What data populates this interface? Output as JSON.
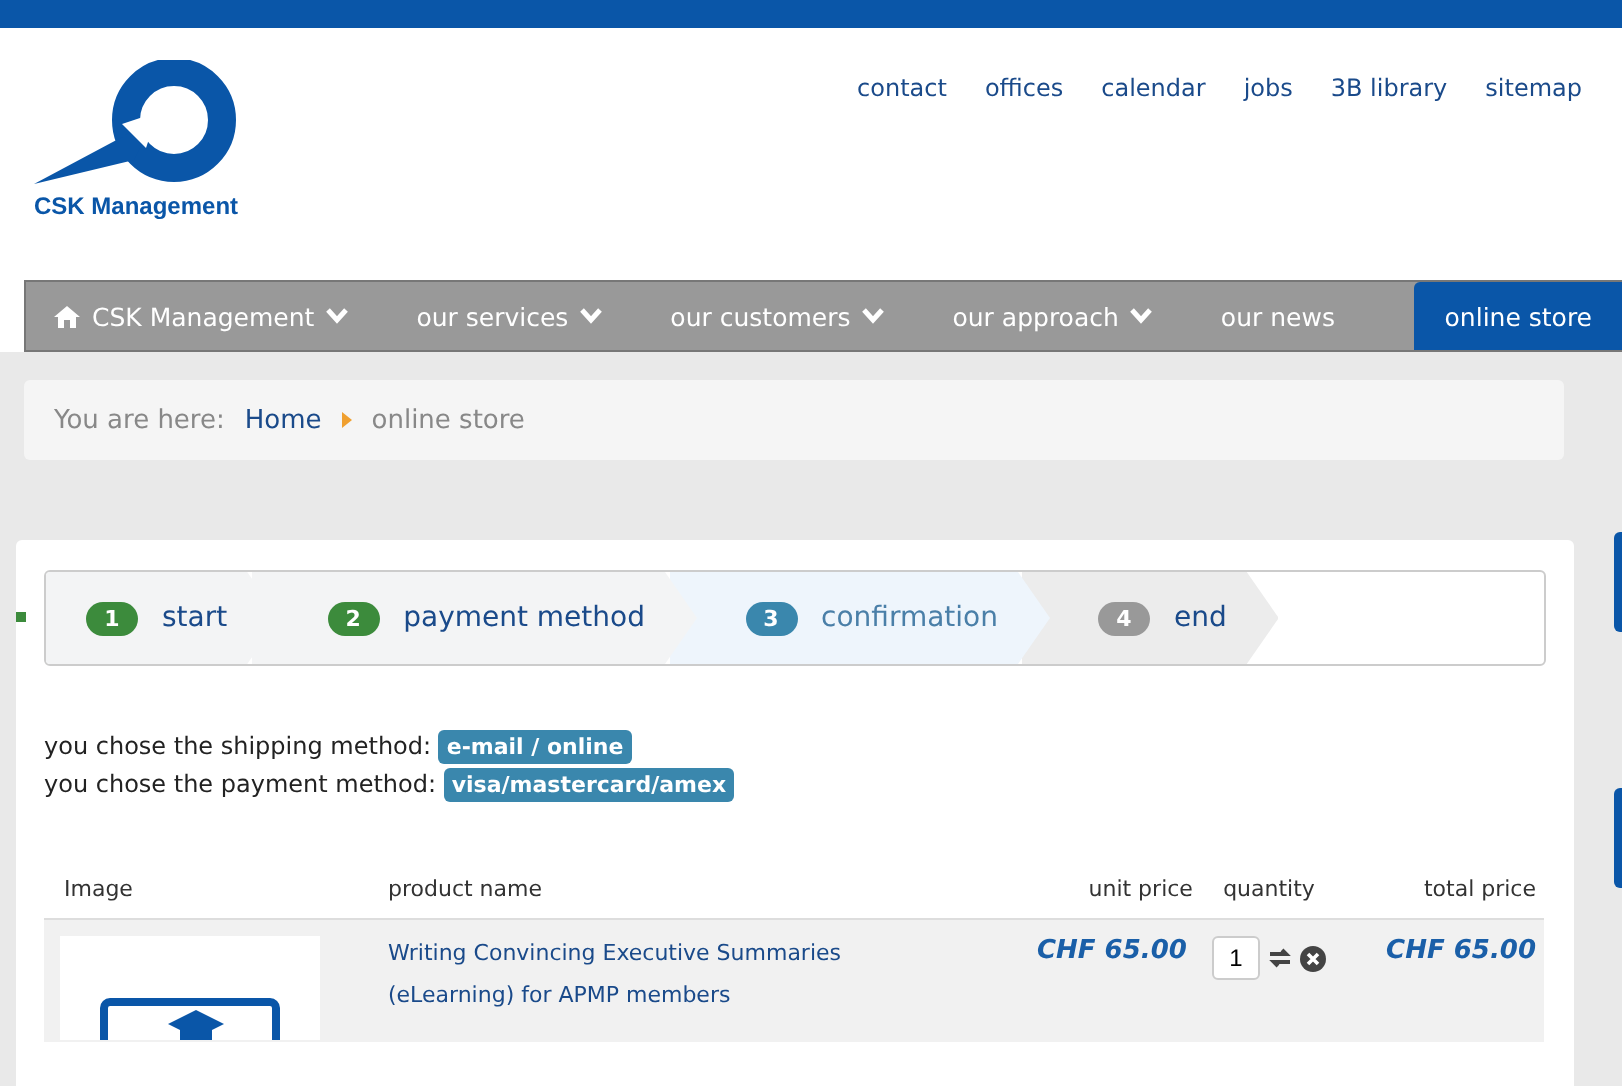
{
  "logo": {
    "text": "CSK Management"
  },
  "top_links": [
    "contact",
    "offices",
    "calendar",
    "jobs",
    "3B library",
    "sitemap"
  ],
  "nav": [
    {
      "label": "CSK Management",
      "home": true,
      "dropdown": true,
      "selected": false
    },
    {
      "label": "our services",
      "home": false,
      "dropdown": true,
      "selected": false
    },
    {
      "label": "our customers",
      "home": false,
      "dropdown": true,
      "selected": false
    },
    {
      "label": "our approach",
      "home": false,
      "dropdown": true,
      "selected": false
    },
    {
      "label": "our news",
      "home": false,
      "dropdown": false,
      "selected": false
    },
    {
      "label": "online store",
      "home": false,
      "dropdown": false,
      "selected": true
    }
  ],
  "breadcrumb": {
    "label": "You are here:",
    "items": [
      {
        "text": "Home",
        "link": true
      },
      {
        "text": "online store",
        "link": false
      }
    ]
  },
  "steps": [
    {
      "number": "1",
      "label": "start",
      "done": true,
      "selected": false
    },
    {
      "number": "2",
      "label": "payment method",
      "done": true,
      "selected": false
    },
    {
      "number": "3",
      "label": "confirmation",
      "done": false,
      "selected": true
    },
    {
      "number": "4",
      "label": "end",
      "done": false,
      "selected": false
    }
  ],
  "choices": [
    {
      "text": "you chose the shipping method:",
      "value": "e-mail / online"
    },
    {
      "text": "you chose the payment method:",
      "value": "visa/mastercard/amex"
    }
  ],
  "table": {
    "columns": [
      "Image",
      "product name",
      "unit price",
      "quantity",
      "total price"
    ],
    "rows": [
      {
        "product": "Writing Convincing Executive Summaries (eLearning) for APMP members",
        "unit_price": "CHF 65.00",
        "quantity": "1",
        "total_price": "CHF 65.00"
      }
    ]
  }
}
